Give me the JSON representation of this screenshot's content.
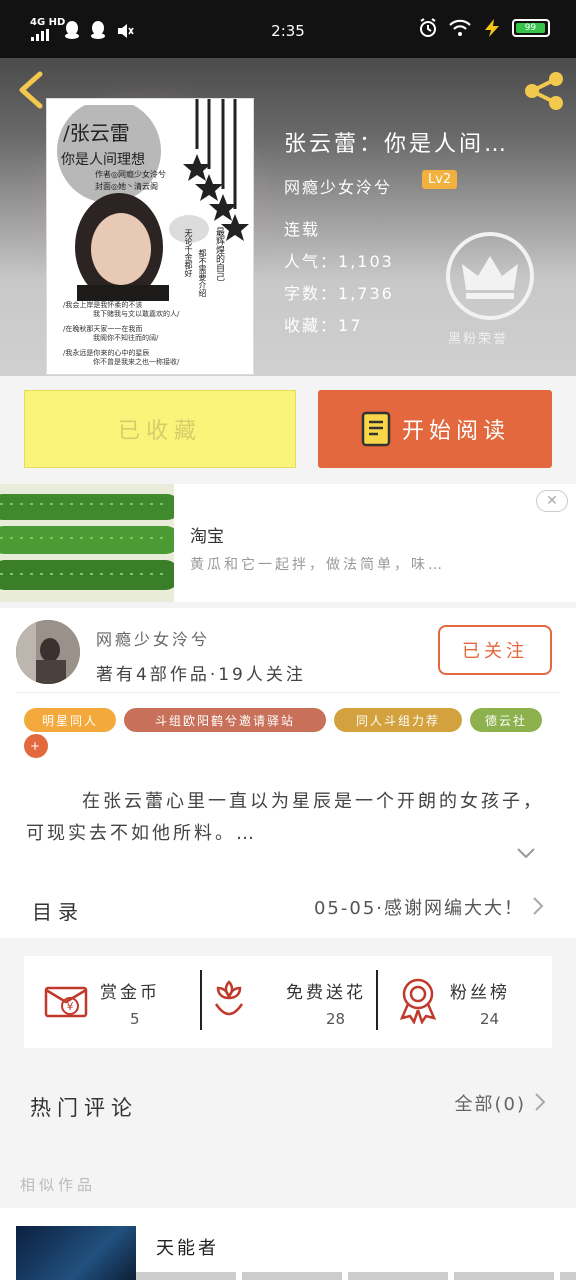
{
  "status_bar": {
    "network": "4G HD",
    "time": "2:35",
    "battery": "99"
  },
  "book": {
    "title": "张云蕾：你是人间…",
    "author": "网瘾少女泠兮",
    "level": "Lv2",
    "status": "连载",
    "popularity_label": "人气：",
    "popularity": "1,103",
    "words_label": "字数：",
    "words": "1,736",
    "collect_label": "收藏：",
    "collect": "17",
    "crown_label": "黑粉荣誉",
    "cover_text": {
      "heading": "/张云雷",
      "subtitle": "你是人间理想",
      "credit": "作者◎网瘾少女泠兮",
      "credit2": "封面◎她丶清云阁",
      "side1": "无论千金都好",
      "side2": "都不需要介绍",
      "side3": "最辉煌的自己",
      "q1": "/我会上岸是我怀柔的不该",
      "q1b": "我下赌我与文以敢嘉欢的人/",
      "q2": "/在晚秋那天家一一在我而",
      "q2b": "我阁你不知往而的阔/",
      "q3": "/我永远是你来的心中的星辰",
      "q3b": "你不曾是我来之也一称接收/"
    }
  },
  "actions": {
    "favorited_label": "已收藏",
    "read_label": "开始阅读"
  },
  "ad": {
    "title": "淘宝",
    "description": "黄瓜和它一起拌，做法简单，味…",
    "close": "✕"
  },
  "author_card": {
    "name": "网瘾少女泠兮",
    "stats": "著有4部作品·19人关注",
    "follow_label": "已关注",
    "tags": [
      {
        "label": "明星同人",
        "color": "#f3a93b"
      },
      {
        "label": "斗组欧阳鹤兮邀请驿站",
        "color": "#c9705a"
      },
      {
        "label": "同人斗组力荐",
        "color": "#d3a23e"
      },
      {
        "label": "德云社",
        "color": "#8db24d"
      },
      {
        "label": "+",
        "color": "#e4683d"
      }
    ],
    "description": "在张云蕾心里一直以为星辰是一个开朗的女孩子，可现实去不如他所料。…"
  },
  "toc": {
    "label": "目录",
    "latest": "05-05·感谢网编大大！"
  },
  "gifts": [
    {
      "name": "赏金币",
      "value": "5",
      "icon": "red-envelope-icon"
    },
    {
      "name": "免费送花",
      "value": "28",
      "icon": "flower-icon"
    },
    {
      "name": "粉丝榜",
      "value": "24",
      "icon": "medal-icon"
    }
  ],
  "comments": {
    "label": "热门评论",
    "all": "全部(0)"
  },
  "similar": {
    "label": "相似作品",
    "book_title": "天能者"
  },
  "colors": {
    "accent": "#e4683d",
    "favorite": "#fbf47b",
    "level": "#f2b13e"
  }
}
